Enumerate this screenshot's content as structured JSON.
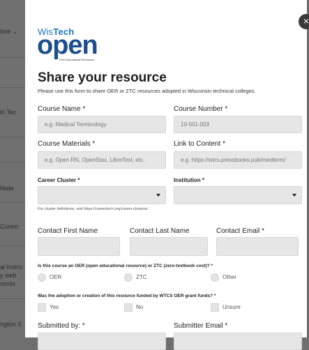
{
  "background": {
    "items": [
      "lore ⌄",
      "in Tec",
      "Mate",
      "Comm",
      "al Instru",
      "y web",
      "remix",
      "ngton S"
    ]
  },
  "modal": {
    "close_glyph": "×",
    "logo": {
      "wis": "Wis",
      "tech": "Tech",
      "open": "open",
      "tagline": "Free Educational Resources"
    },
    "title": "Share your resource",
    "intro": "Please use this form to share OER or ZTC resources adopted in Wisconsin technical colleges.",
    "fields": {
      "course_name": {
        "label": "Course Name *",
        "placeholder": "e.g. Medical Terminology"
      },
      "course_number": {
        "label": "Course Number *",
        "placeholder": "10-501-003"
      },
      "course_materials": {
        "label": "Course Materials *",
        "placeholder": "e.g. Open RN, OpenStax, LibreText, etc."
      },
      "link_to_content": {
        "label": "Link to Content *",
        "placeholder": "e.g. https://wtcs.pressbooks.pub/medterm/"
      },
      "career_cluster": {
        "label": "Career Cluster *",
        "hint": "For cluster definitions, visit https://careertech.org/career-clusters/."
      },
      "institution": {
        "label": "Institution *"
      },
      "contact_first": {
        "label": "Contact First Name"
      },
      "contact_last": {
        "label": "Contact Last Name"
      },
      "contact_email": {
        "label": "Contact Email *"
      },
      "submitted_by": {
        "label": "Submitted by: *"
      },
      "submitter_email": {
        "label": "Submitter Email *"
      }
    },
    "q_type": {
      "question": "Is this course an OER (open educational resource) or ZTC (zero-textbook cost)? *",
      "options": [
        "OER",
        "ZTC",
        "Other"
      ]
    },
    "q_funding": {
      "question": "Was the adoption or creation of this resource funded by WTCS OER grant funds? *",
      "options": [
        "Yes",
        "No",
        "Unsure"
      ]
    }
  }
}
